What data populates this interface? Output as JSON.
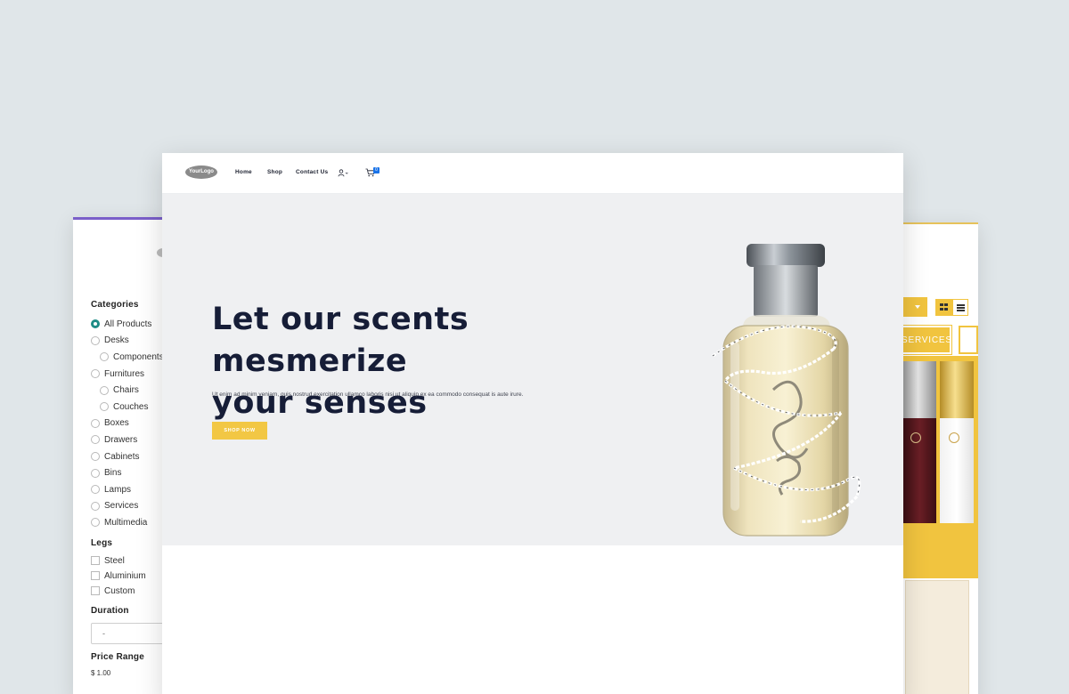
{
  "header": {
    "logo_text": "YourLogo",
    "nav": [
      {
        "label": "Home"
      },
      {
        "label": "Shop"
      },
      {
        "label": "Contact Us"
      }
    ],
    "user_icon": "user-icon",
    "cart_icon": "cart-icon",
    "cart_count": "0"
  },
  "hero": {
    "title_line1": "Let our scents mesmerize",
    "title_line2": "your senses",
    "text": "Ut enim ad minim veniam, quis nostrud exercitation ullamco laboris nisi ut aliquip ex ea commodo consequat is aute irure.",
    "button_label": "SHOP NOW",
    "image": "perfume-bottle"
  },
  "filters": {
    "categories_heading": "Categories",
    "categories": [
      {
        "label": "All Products",
        "checked": true,
        "sub": false
      },
      {
        "label": "Desks",
        "checked": false,
        "sub": false
      },
      {
        "label": "Components",
        "checked": false,
        "sub": true
      },
      {
        "label": "Furnitures",
        "checked": false,
        "sub": false
      },
      {
        "label": "Chairs",
        "checked": false,
        "sub": true
      },
      {
        "label": "Couches",
        "checked": false,
        "sub": true
      },
      {
        "label": "Boxes",
        "checked": false,
        "sub": false
      },
      {
        "label": "Drawers",
        "checked": false,
        "sub": false
      },
      {
        "label": "Cabinets",
        "checked": false,
        "sub": false
      },
      {
        "label": "Bins",
        "checked": false,
        "sub": false
      },
      {
        "label": "Lamps",
        "checked": false,
        "sub": false
      },
      {
        "label": "Services",
        "checked": false,
        "sub": false
      },
      {
        "label": "Multimedia",
        "checked": false,
        "sub": false
      }
    ],
    "legs_heading": "Legs",
    "legs": [
      {
        "label": "Steel"
      },
      {
        "label": "Aluminium"
      },
      {
        "label": "Custom"
      }
    ],
    "duration_heading": "Duration",
    "duration_value": "-",
    "price_heading": "Price Range",
    "price_value": "$ 1.00"
  },
  "shop_right": {
    "services_label": "SERVICES"
  },
  "colors": {
    "accent": "#f2c744",
    "navy": "#161d37",
    "hero_bg": "#eff0f2",
    "page_bg": "#e0e6e9",
    "radio_checked": "#1e8c86"
  }
}
